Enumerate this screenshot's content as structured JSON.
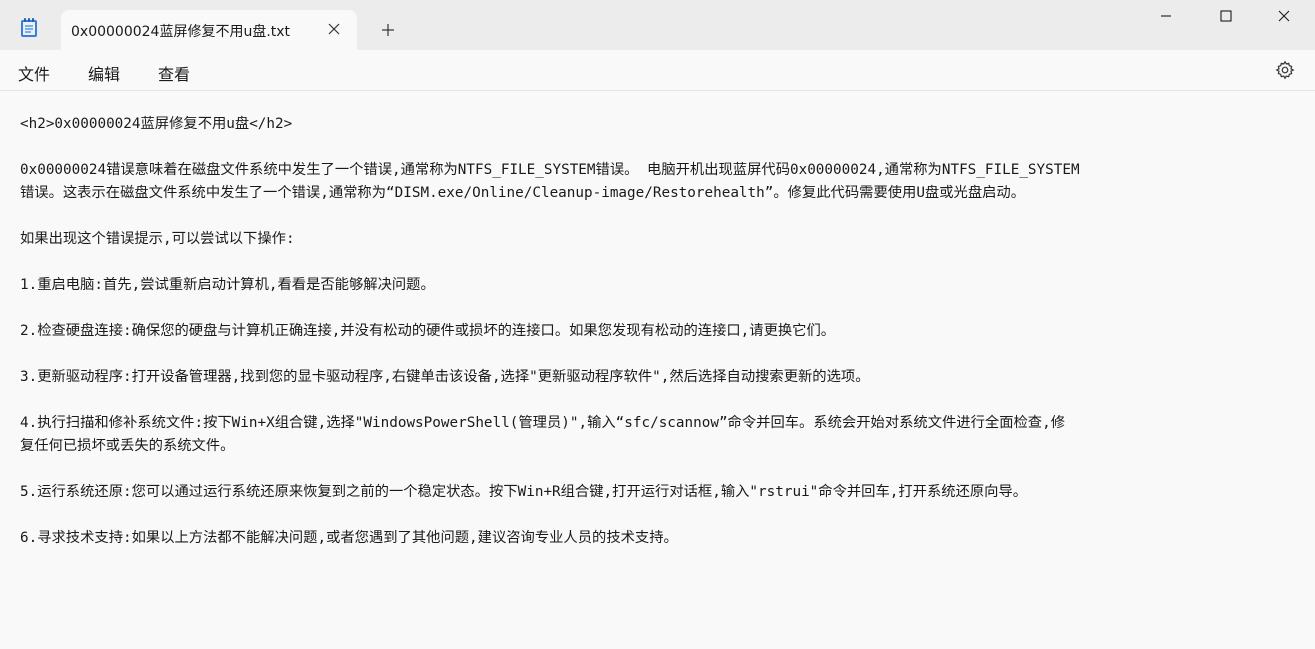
{
  "window": {
    "tab_title": "0x00000024蓝屏修复不用u盘.txt",
    "icons": {
      "app": "notepad-icon",
      "tab_close": "close-icon",
      "new_tab": "plus-icon",
      "minimize": "minimize-icon",
      "maximize": "maximize-icon",
      "close": "close-icon",
      "settings": "gear-icon"
    }
  },
  "menu": {
    "file": "文件",
    "edit": "编辑",
    "view": "查看"
  },
  "document": {
    "lines": [
      "<h2>0x00000024蓝屏修复不用u盘</h2>",
      "",
      "0x00000024错误意味着在磁盘文件系统中发生了一个错误,通常称为NTFS_FILE_SYSTEM错误。 电脑开机出现蓝屏代码0x00000024,通常称为NTFS_FILE_SYSTEM",
      "错误。这表示在磁盘文件系统中发生了一个错误,通常称为“DISM.exe/Online/Cleanup-image/Restorehealth”。修复此代码需要使用U盘或光盘启动。",
      "",
      "如果出现这个错误提示,可以尝试以下操作:",
      "",
      "1.重启电脑:首先,尝试重新启动计算机,看看是否能够解决问题。",
      "",
      "2.检查硬盘连接:确保您的硬盘与计算机正确连接,并没有松动的硬件或损坏的连接口。如果您发现有松动的连接口,请更换它们。",
      "",
      "3.更新驱动程序:打开设备管理器,找到您的显卡驱动程序,右键单击该设备,选择\"更新驱动程序软件\",然后选择自动搜索更新的选项。",
      "",
      "4.执行扫描和修补系统文件:按下Win+X组合键,选择\"WindowsPowerShell(管理员)\",输入“sfc/scannow”命令并回车。系统会开始对系统文件进行全面检查,修",
      "复任何已损坏或丢失的系统文件。",
      "",
      "5.运行系统还原:您可以通过运行系统还原来恢复到之前的一个稳定状态。按下Win+R组合键,打开运行对话框,输入\"rstrui\"命令并回车,打开系统还原向导。",
      "",
      "6.寻求技术支持:如果以上方法都不能解决问题,或者您遇到了其他问题,建议咨询专业人员的技术支持。"
    ]
  }
}
